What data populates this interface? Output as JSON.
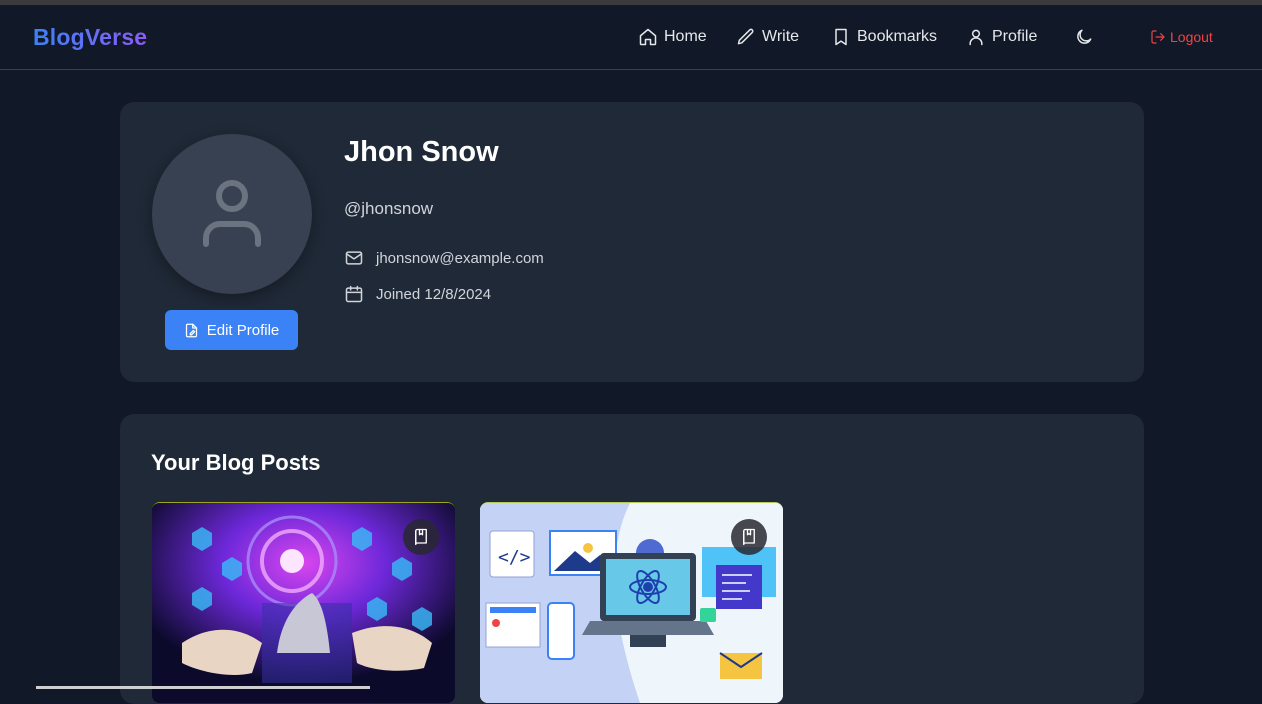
{
  "app": {
    "brand": "BlogVerse"
  },
  "nav": {
    "home": "Home",
    "write": "Write",
    "bookmarks": "Bookmarks",
    "profile": "Profile",
    "logout": "Logout",
    "icons": [
      "home-icon",
      "pencil-icon",
      "bookmark-icon",
      "user-icon",
      "moon-icon",
      "logout-icon"
    ]
  },
  "profile": {
    "name": "Jhon Snow",
    "handle": "@jhonsnow",
    "email": "jhonsnow@example.com",
    "joined": "Joined 12/8/2024",
    "edit_label": "Edit Profile"
  },
  "posts": {
    "title": "Your Blog Posts",
    "items": [
      {
        "image": "ai-robot-hand-illustration",
        "bookmark_icon": "book-icon"
      },
      {
        "image": "web-development-laptop-illustration",
        "bookmark_icon": "book-icon"
      }
    ]
  },
  "colors": {
    "background": "#111827",
    "card": "#1f2937",
    "accent": "#3b82f6",
    "brand_gradient": [
      "#3b82f6",
      "#8b5cf6"
    ],
    "logout": "#ef4444"
  }
}
